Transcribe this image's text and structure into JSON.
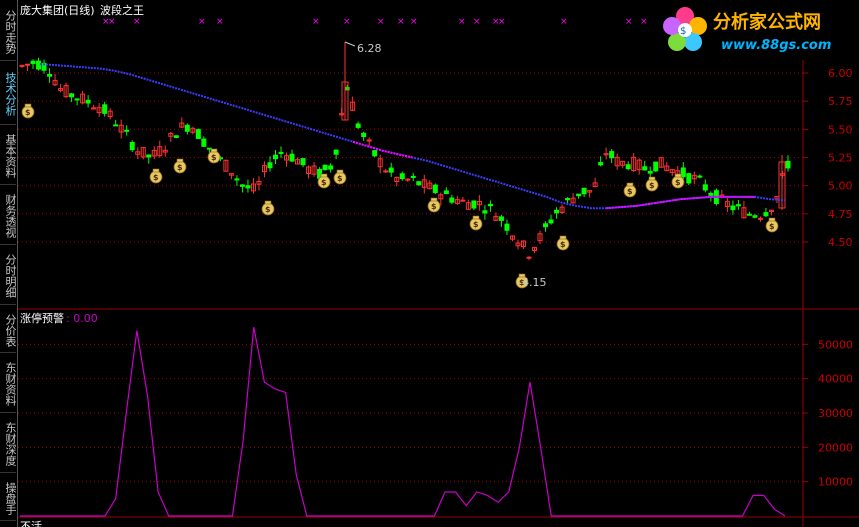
{
  "window": {
    "stock_name": "庞大集团(日线)",
    "indicator_name": "波段之王",
    "sub_indicator_label": "涨停预警",
    "sub_indicator_value": ": 0.00",
    "bottom_text_partial": "不活"
  },
  "logo": {
    "brand": "分析家公式网",
    "url": "www.88gs.com"
  },
  "sidebar": {
    "items": [
      {
        "label": "分时走势"
      },
      {
        "label": "技术分析"
      },
      {
        "label": "基本资料"
      },
      {
        "label": "财务透视"
      },
      {
        "label": "分时明细"
      },
      {
        "label": "分价表"
      },
      {
        "label": "东财资料"
      },
      {
        "label": "东财深度"
      },
      {
        "label": "操盘手"
      }
    ]
  },
  "annotations": {
    "high_price": "6.28",
    "low_price": "4.15"
  },
  "colors": {
    "up": "#ff3232",
    "down": "#00ff00",
    "ma_blue": "#3c3cff",
    "ma_magenta": "#ff00ff",
    "axis": "#a00000",
    "sub_line": "#c800c8",
    "tab_active": "#5fd7ff"
  },
  "chart_data": [
    {
      "type": "candlestick",
      "title": "庞大集团(日线) 波段之王",
      "y_ticks": [
        "6.00",
        "5.75",
        "5.50",
        "5.25",
        "5.00",
        "4.75",
        "4.50"
      ],
      "ylim": [
        4.33,
        6.28
      ],
      "high": 6.28,
      "low": 4.15,
      "ma_line": [
        6.08,
        6.07,
        6.06,
        6.05,
        6.04,
        6.02,
        5.99,
        5.95,
        5.91,
        5.87,
        5.83,
        5.79,
        5.75,
        5.71,
        5.67,
        5.63,
        5.59,
        5.55,
        5.51,
        5.47,
        5.43,
        5.39,
        5.35,
        5.31,
        5.28,
        5.25,
        5.22,
        5.18,
        5.14,
        5.1,
        5.06,
        5.02,
        4.98,
        4.94,
        4.9,
        4.85,
        4.82,
        4.8,
        4.8,
        4.81,
        4.82,
        4.84,
        4.86,
        4.88,
        4.89,
        4.9,
        4.9,
        4.9,
        4.9,
        4.88,
        4.87
      ]
    },
    {
      "type": "line",
      "title": "涨停预警",
      "y_ticks": [
        "50000",
        "40000",
        "30000",
        "20000",
        "10000"
      ],
      "ylim": [
        0,
        60000
      ],
      "values": [
        0,
        0,
        0,
        0,
        0,
        0,
        0,
        0,
        0,
        5000,
        30000,
        54000,
        35000,
        7000,
        0,
        0,
        0,
        0,
        0,
        0,
        0,
        22000,
        55000,
        39000,
        37000,
        36000,
        12000,
        0,
        0,
        0,
        0,
        0,
        0,
        0,
        0,
        0,
        0,
        0,
        0,
        0,
        7000,
        7000,
        3000,
        7000,
        6000,
        4000,
        7000,
        20000,
        39000,
        20000,
        0,
        0,
        0,
        0,
        0,
        0,
        0,
        0,
        0,
        0,
        0,
        0,
        0,
        0,
        0,
        0,
        0,
        0,
        0,
        6000,
        6000,
        2000,
        0
      ]
    }
  ]
}
